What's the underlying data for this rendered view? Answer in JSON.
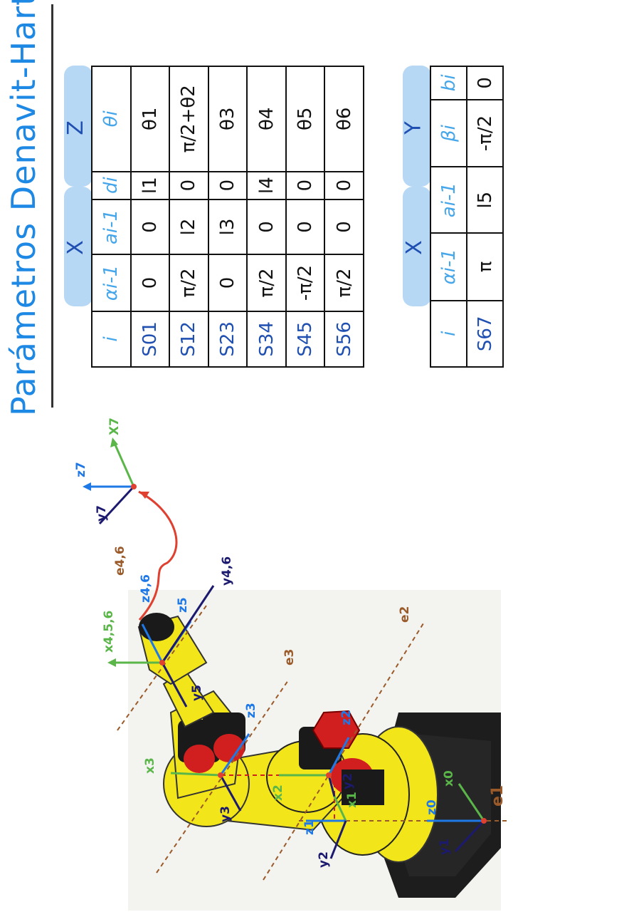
{
  "title": "Parámetros Denavit-Hartenberg.",
  "table1": {
    "group_x": "X",
    "group_z": "Z",
    "headers": [
      "i",
      "αi-1",
      "ai-1",
      "di",
      "θi"
    ],
    "rows": [
      [
        "S01",
        "0",
        "0",
        "l1",
        "θ1"
      ],
      [
        "S12",
        "π/2",
        "l2",
        "0",
        "π/2+θ2"
      ],
      [
        "S23",
        "0",
        "l3",
        "0",
        "θ3"
      ],
      [
        "S34",
        "π/2",
        "0",
        "l4",
        "θ4"
      ],
      [
        "S45",
        "-π/2",
        "0",
        "0",
        "θ5"
      ],
      [
        "S56",
        "π/2",
        "0",
        "0",
        "θ6"
      ]
    ]
  },
  "table2": {
    "group_x": "X",
    "group_y": "Y",
    "headers": [
      "i",
      "αi-1",
      "ai-1",
      "βi",
      "bi"
    ],
    "rows": [
      [
        "S67",
        "π",
        "l5",
        "-π/2",
        "0"
      ]
    ]
  },
  "diagram": {
    "axis_labels": {
      "x7": "X7",
      "z7": "z7",
      "y7": "y7",
      "e46": "e4,6",
      "z46": "z4,6",
      "y46": "y4,6",
      "x456": "x4,5,6",
      "z5": "z5",
      "e3": "e3",
      "e2": "e2",
      "y5": "y5",
      "z3": "z3",
      "x3": "x3",
      "y3": "y3",
      "x2": "x2",
      "z2": "z2",
      "y2": "y2",
      "x1": "x1",
      "z1": "z1",
      "y1": "y1",
      "x0": "x0",
      "z0": "z0",
      "e1": "e1"
    },
    "colors": {
      "x_axis": "#5bb64a",
      "z_axis": "#1e78e6",
      "y_axis": "#1c1a6e",
      "joint_axis": "#9a5a2a",
      "transform_arc": "#e04030",
      "robot_body": "#f2e61a",
      "robot_dark": "#1a1a1a",
      "motor_red": "#d11f1f"
    }
  }
}
